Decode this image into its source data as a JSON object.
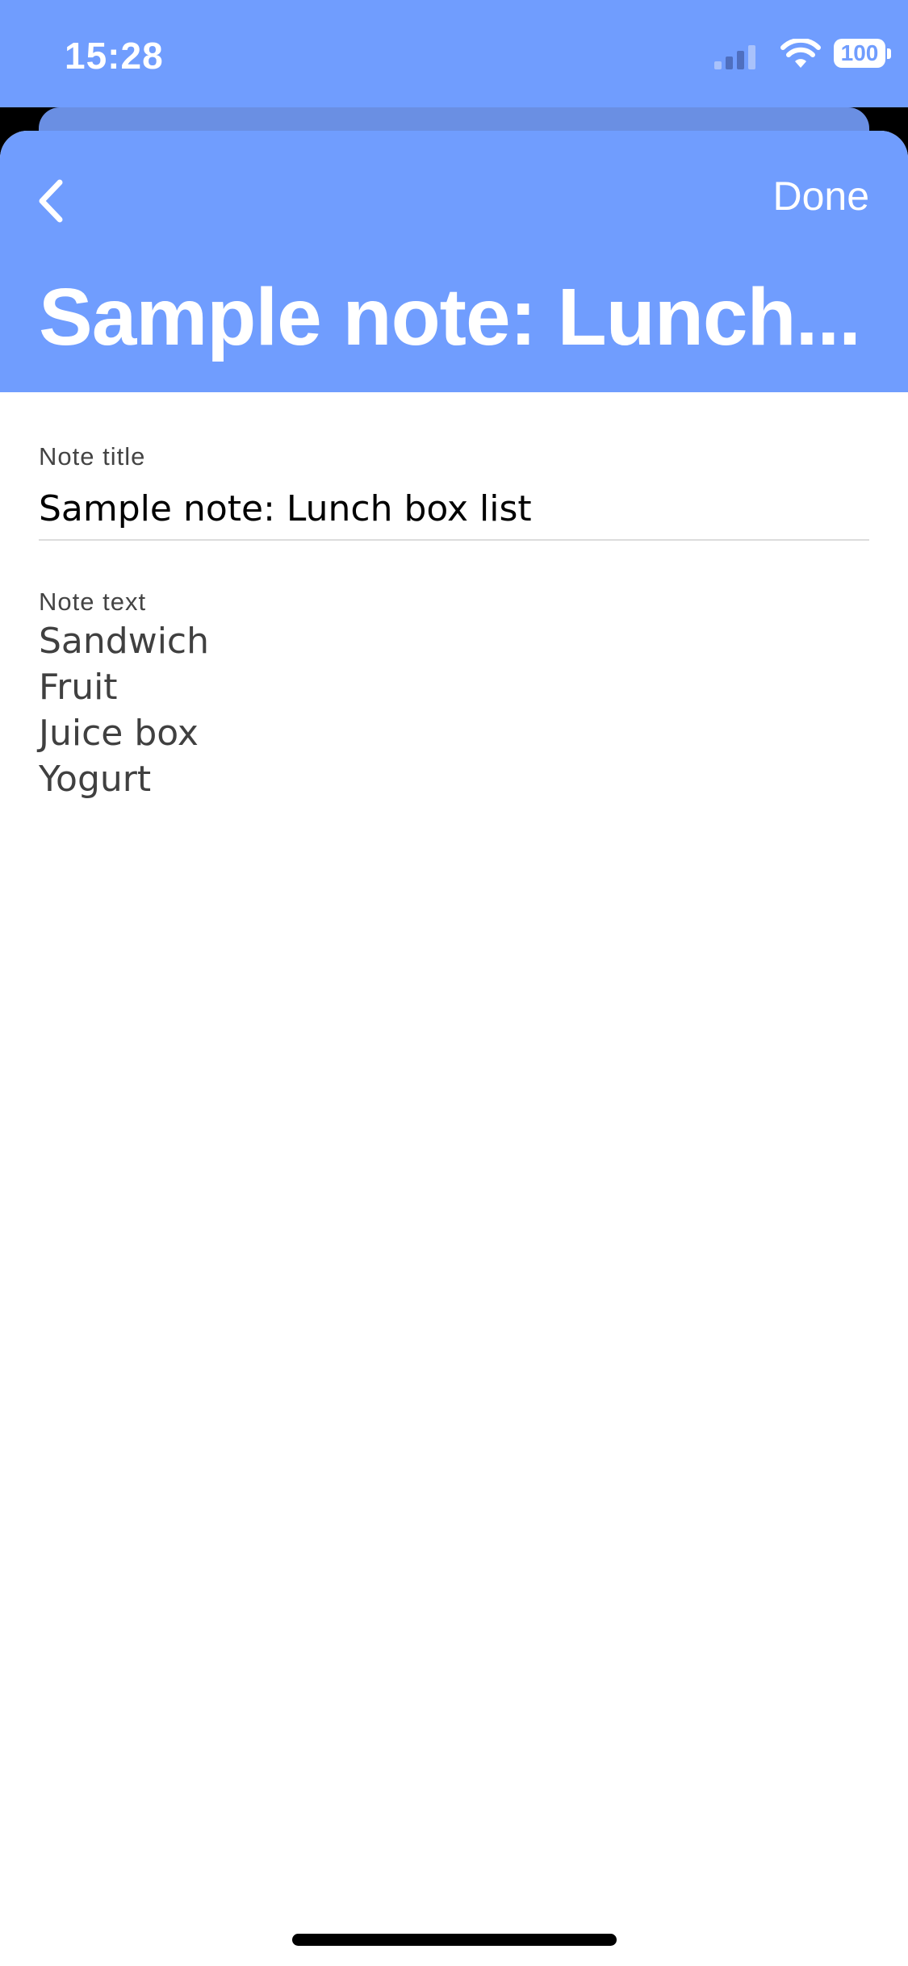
{
  "status_bar": {
    "time": "15:28",
    "battery_level": "100",
    "signal_icon": "cellular-signal-icon",
    "wifi_icon": "wifi-icon",
    "battery_icon": "battery-icon"
  },
  "nav": {
    "back_icon": "chevron-left-icon",
    "done_label": "Done",
    "large_title": "Sample note: Lunch..."
  },
  "form": {
    "title_label": "Note title",
    "title_value": "Sample note: Lunch box list",
    "text_label": "Note text",
    "text_lines": [
      "Sandwich",
      "Fruit",
      "Juice box",
      "Yogurt"
    ]
  },
  "colors": {
    "accent": "#709dfe",
    "background": "#ffffff"
  }
}
